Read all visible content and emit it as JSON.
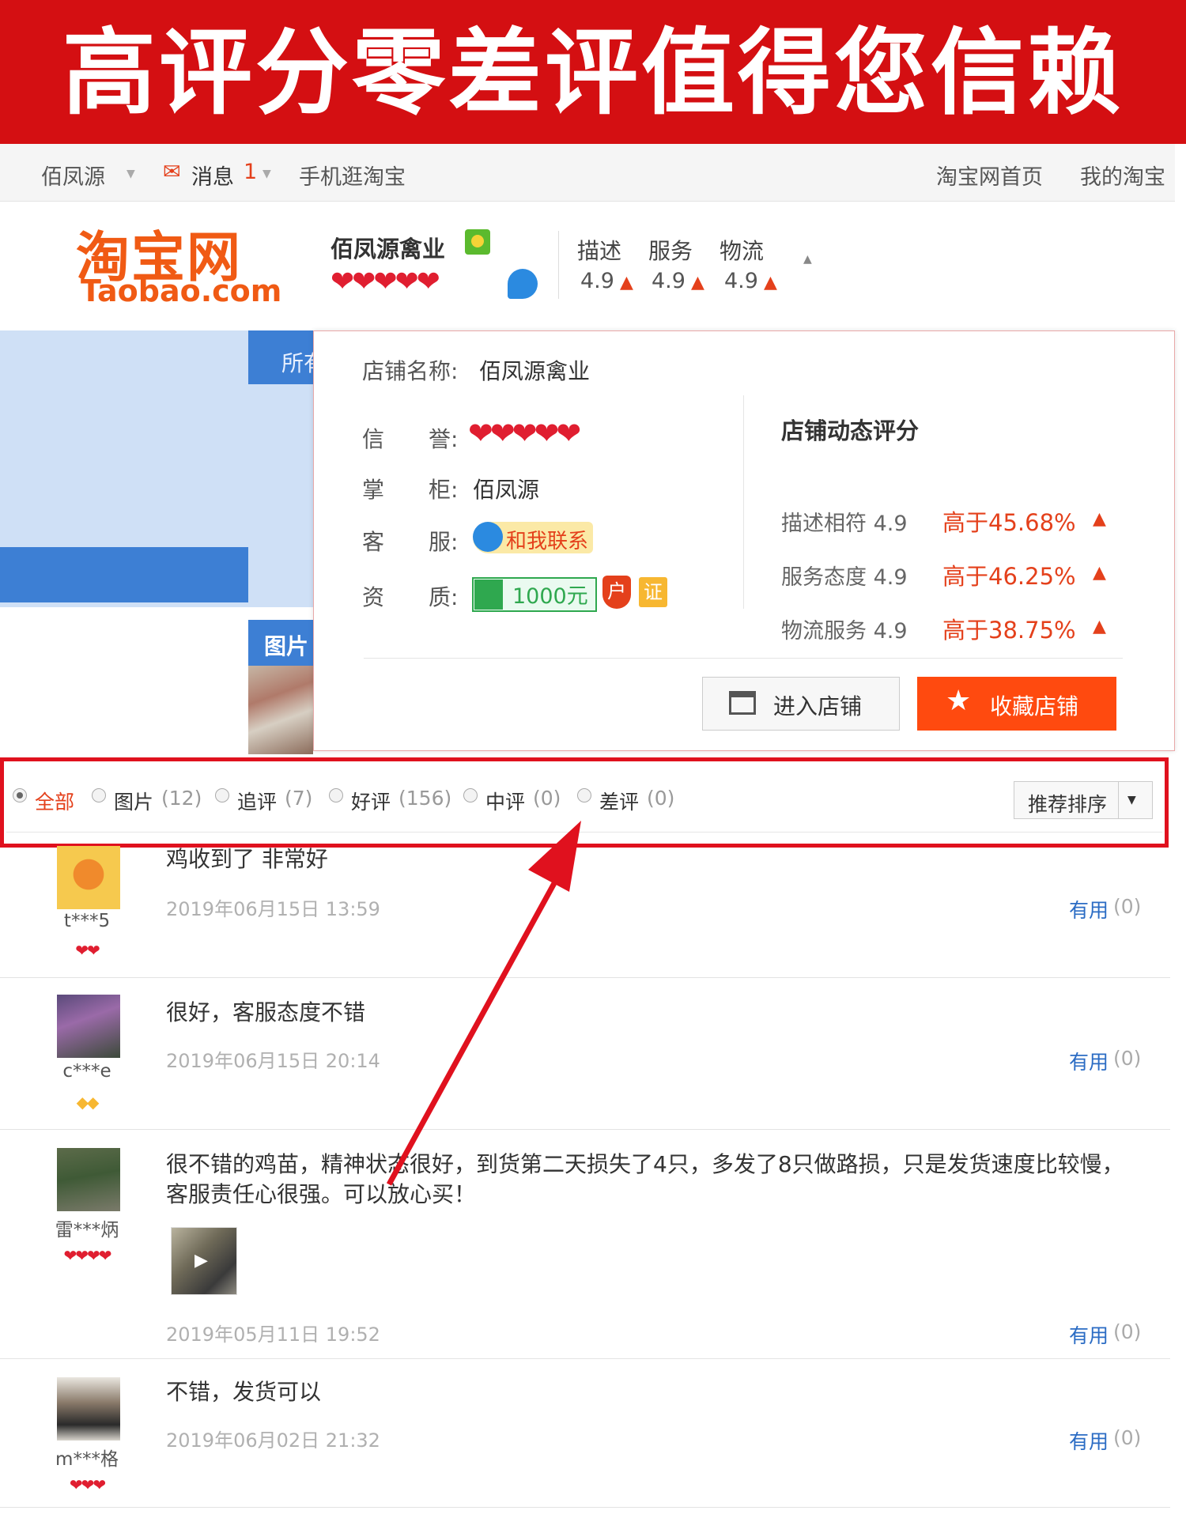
{
  "banner": {
    "title": "高评分零差评值得您信赖"
  },
  "topbar": {
    "user": "佰凤源",
    "messages_label": "消息",
    "messages_count": "1",
    "mobile": "手机逛淘宝",
    "home": "淘宝网首页",
    "my_taobao": "我的淘宝"
  },
  "header": {
    "logo_cn": "淘宝网",
    "logo_en": "Taobao.com",
    "shop_name": "佰凤源禽业",
    "hearts": "❤❤❤❤❤",
    "dsr": [
      {
        "label": "描述",
        "value": "4.9"
      },
      {
        "label": "服务",
        "value": "4.9"
      },
      {
        "label": "物流",
        "value": "4.9"
      }
    ]
  },
  "left_fragments": {
    "tab_text": "所有",
    "tab2_text": "图片"
  },
  "popup": {
    "name_label": "店铺名称:",
    "name_value": "佰凤源禽业",
    "credit_label": "信　　誉:",
    "credit_hearts": "❤❤❤❤❤",
    "keeper_label": "掌　　柜:",
    "keeper_value": "佰凤源",
    "service_label": "客　　服:",
    "service_contact": "和我联系",
    "qual_label": "资　　质:",
    "qual_amount": "1000元",
    "qual_shield": "户",
    "qual_zheng": "证",
    "dynamic_title": "店铺动态评分",
    "scores": [
      {
        "label": "描述相符",
        "value": "4.9",
        "compare": "高于45.68%"
      },
      {
        "label": "服务态度",
        "value": "4.9",
        "compare": "高于46.25%"
      },
      {
        "label": "物流服务",
        "value": "4.9",
        "compare": "高于38.75%"
      }
    ],
    "enter_button": "进入店铺",
    "fav_button": "收藏店铺"
  },
  "filters": {
    "items": [
      {
        "label": "全部",
        "count": "",
        "selected": true
      },
      {
        "label": "图片",
        "count": "(12)",
        "selected": false
      },
      {
        "label": "追评",
        "count": "(7)",
        "selected": false
      },
      {
        "label": "好评",
        "count": "(156)",
        "selected": false
      },
      {
        "label": "中评",
        "count": "(0)",
        "selected": false
      },
      {
        "label": "差评",
        "count": "(0)",
        "selected": false
      }
    ],
    "sort_label": "推荐排序"
  },
  "reviews": [
    {
      "user": "t***5",
      "badge": "❤❤",
      "text": "鸡收到了 非常好",
      "date": "2019年06月15日 13:59",
      "useful": "有用",
      "useful_count": "(0)"
    },
    {
      "user": "c***e",
      "badge": "◆◆",
      "text": "很好，客服态度不错",
      "date": "2019年06月15日 20:14",
      "useful": "有用",
      "useful_count": "(0)"
    },
    {
      "user": "雷***炳",
      "badge": "❤❤❤❤",
      "text": "很不错的鸡苗，精神状态很好，到货第二天损失了4只，多发了8只做路损，只是发货速度比较慢，客服责任心很强。可以放心买！",
      "date": "2019年05月11日 19:52",
      "useful": "有用",
      "useful_count": "(0)"
    },
    {
      "user": "m***格",
      "badge": "❤❤❤",
      "text": "不错，发货可以",
      "date": "2019年06月02日 21:32",
      "useful": "有用",
      "useful_count": "(0)"
    }
  ],
  "colors": {
    "banner_red": "#d40f12",
    "taobao_orange": "#f05a14",
    "accent_red": "#e4401b",
    "link_blue": "#2b6cc4",
    "fav_orange": "#ff4a0f"
  }
}
